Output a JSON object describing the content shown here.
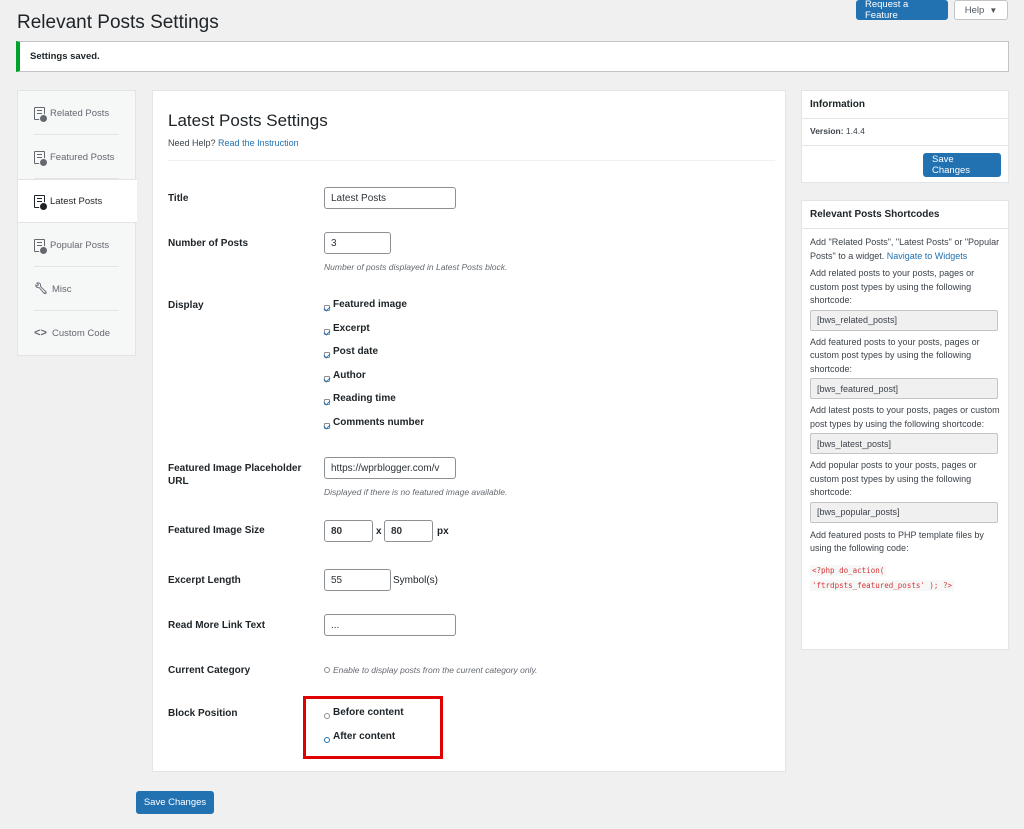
{
  "page": {
    "title": "Relevant Posts Settings"
  },
  "header_buttons": {
    "request_feature": "Request a Feature",
    "help": "Help"
  },
  "notice": {
    "text": "Settings saved."
  },
  "nav": {
    "items": [
      {
        "label": "Related Posts",
        "icon": "related-posts-icon"
      },
      {
        "label": "Featured Posts",
        "icon": "featured-posts-icon"
      },
      {
        "label": "Latest Posts",
        "icon": "latest-posts-icon",
        "active": true
      },
      {
        "label": "Popular Posts",
        "icon": "popular-posts-icon"
      },
      {
        "label": "Misc",
        "icon": "wrench-icon"
      },
      {
        "label": "Custom Code",
        "icon": "code-icon"
      }
    ]
  },
  "main": {
    "heading": "Latest Posts Settings",
    "need_help": "Need Help?",
    "instruction_link": "Read the Instruction",
    "title_label": "Title",
    "title_value": "Latest Posts",
    "num_posts_label": "Number of Posts",
    "num_posts_value": "3",
    "num_posts_desc": "Number of posts displayed in Latest Posts block.",
    "display_label": "Display",
    "display_options": [
      {
        "label": "Featured image",
        "checked": true
      },
      {
        "label": "Excerpt",
        "checked": true
      },
      {
        "label": "Post date",
        "checked": true
      },
      {
        "label": "Author",
        "checked": true
      },
      {
        "label": "Reading time",
        "checked": true
      },
      {
        "label": "Comments number",
        "checked": true
      }
    ],
    "placeholder_label": "Featured Image Placeholder URL",
    "placeholder_value": "https://wprblogger.com/v",
    "placeholder_desc": "Displayed if there is no featured image available.",
    "image_size_label": "Featured Image Size",
    "image_width": "80",
    "image_height": "80",
    "size_separator": "x",
    "size_unit": "px",
    "excerpt_label": "Excerpt Length",
    "excerpt_value": "55",
    "excerpt_unit": "Symbol(s)",
    "read_more_label": "Read More Link Text",
    "read_more_value": "...",
    "current_category_label": "Current Category",
    "current_category_desc": "Enable to display posts from the current category only.",
    "current_category_checked": false,
    "block_position_label": "Block Position",
    "block_positions": [
      {
        "label": "Before content",
        "selected": false
      },
      {
        "label": "After content",
        "selected": true
      }
    ],
    "save_label": "Save Changes"
  },
  "info_box": {
    "title": "Information",
    "version_label": "Version:",
    "version_value": "1.4.4",
    "save_label": "Save Changes"
  },
  "shortcodes_box": {
    "title": "Relevant Posts Shortcodes",
    "intro": "Add \"Related Posts\", \"Latest Posts\" or \"Popular Posts\" to a widget.",
    "widgets_link": "Navigate to Widgets",
    "related_text": "Add related posts to your posts, pages or custom post types by using the following shortcode:",
    "related_code": "[bws_related_posts]",
    "featured_text": "Add featured posts to your posts, pages or custom post types by using the following shortcode:",
    "featured_code": "[bws_featured_post]",
    "latest_text": "Add latest posts to your posts, pages or custom post types by using the following shortcode:",
    "latest_code": "[bws_latest_posts]",
    "popular_text": "Add popular posts to your posts, pages or custom post types by using the following shortcode:",
    "popular_code": "[bws_popular_posts]",
    "php_text": "Add featured posts to PHP template files by using the following code:",
    "php_code_1": "<?php do_action(",
    "php_code_2": "'ftrdpsts_featured_posts' ); ?>"
  },
  "colors": {
    "primary": "#2271b1",
    "success": "#00a32a",
    "highlight": "#e00000"
  }
}
